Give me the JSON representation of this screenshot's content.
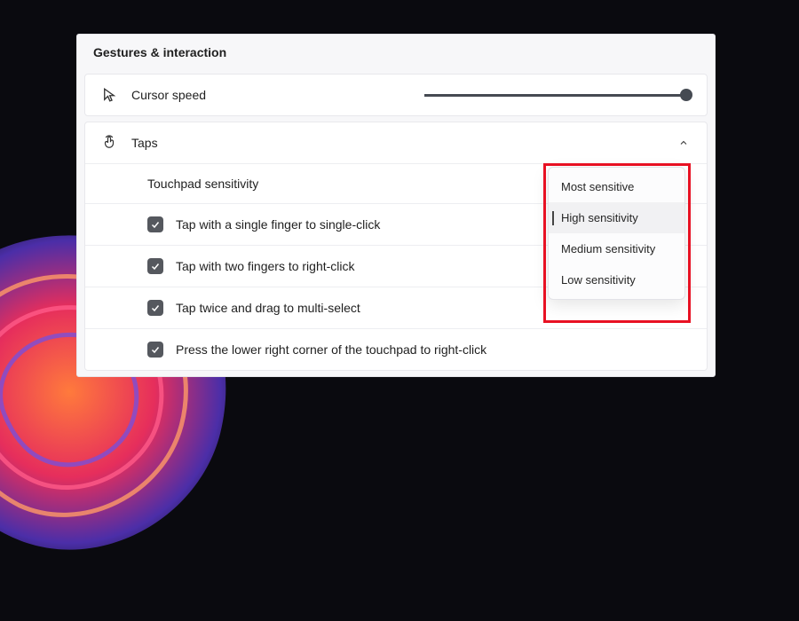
{
  "section_title": "Gestures & interaction",
  "cursor_card": {
    "label": "Cursor speed"
  },
  "taps_card": {
    "label": "Taps"
  },
  "touchpad_sensitivity_label": "Touchpad sensitivity",
  "options": [
    {
      "label": "Tap with a single finger to single-click"
    },
    {
      "label": "Tap with two fingers to right-click"
    },
    {
      "label": "Tap twice and drag to multi-select"
    },
    {
      "label": "Press the lower right corner of the touchpad to right-click"
    }
  ],
  "dropdown": {
    "items": [
      {
        "label": "Most sensitive"
      },
      {
        "label": "High sensitivity"
      },
      {
        "label": "Medium sensitivity"
      },
      {
        "label": "Low sensitivity"
      }
    ],
    "selected_index": 1
  }
}
